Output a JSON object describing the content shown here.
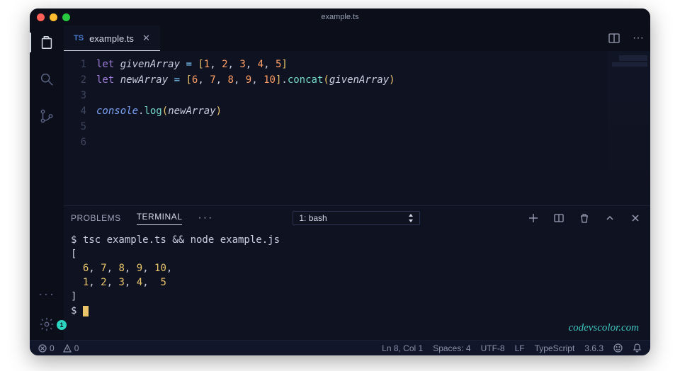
{
  "title": "example.ts",
  "tabs": [
    {
      "badge": "TS",
      "label": "example.ts",
      "close": "✕"
    }
  ],
  "code": {
    "lines": [
      {
        "n": "1",
        "tokens": [
          {
            "t": "let ",
            "c": "kw"
          },
          {
            "t": "givenArray",
            "c": "var"
          },
          {
            "t": " ",
            "c": ""
          },
          {
            "t": "=",
            "c": "op"
          },
          {
            "t": " ",
            "c": ""
          },
          {
            "t": "[",
            "c": "pn"
          },
          {
            "t": "1",
            "c": "num"
          },
          {
            "t": ", ",
            "c": ""
          },
          {
            "t": "2",
            "c": "num"
          },
          {
            "t": ", ",
            "c": ""
          },
          {
            "t": "3",
            "c": "num"
          },
          {
            "t": ", ",
            "c": ""
          },
          {
            "t": "4",
            "c": "num"
          },
          {
            "t": ", ",
            "c": ""
          },
          {
            "t": "5",
            "c": "num"
          },
          {
            "t": "]",
            "c": "pn"
          }
        ]
      },
      {
        "n": "2",
        "tokens": [
          {
            "t": "let ",
            "c": "kw"
          },
          {
            "t": "newArray",
            "c": "var"
          },
          {
            "t": " ",
            "c": ""
          },
          {
            "t": "=",
            "c": "op"
          },
          {
            "t": " ",
            "c": ""
          },
          {
            "t": "[",
            "c": "pn"
          },
          {
            "t": "6",
            "c": "num"
          },
          {
            "t": ", ",
            "c": ""
          },
          {
            "t": "7",
            "c": "num"
          },
          {
            "t": ", ",
            "c": ""
          },
          {
            "t": "8",
            "c": "num"
          },
          {
            "t": ", ",
            "c": ""
          },
          {
            "t": "9",
            "c": "num"
          },
          {
            "t": ", ",
            "c": ""
          },
          {
            "t": "10",
            "c": "num"
          },
          {
            "t": "]",
            "c": "pn"
          },
          {
            "t": ".",
            "c": ""
          },
          {
            "t": "concat",
            "c": "fn"
          },
          {
            "t": "(",
            "c": "pn"
          },
          {
            "t": "givenArray",
            "c": "var"
          },
          {
            "t": ")",
            "c": "pn"
          }
        ]
      },
      {
        "n": "3",
        "tokens": []
      },
      {
        "n": "4",
        "tokens": [
          {
            "t": "console",
            "c": "obj"
          },
          {
            "t": ".",
            "c": ""
          },
          {
            "t": "log",
            "c": "fn"
          },
          {
            "t": "(",
            "c": "pn"
          },
          {
            "t": "newArray",
            "c": "var"
          },
          {
            "t": ")",
            "c": "pn"
          }
        ]
      },
      {
        "n": "5",
        "tokens": []
      },
      {
        "n": "6",
        "tokens": []
      }
    ]
  },
  "panel": {
    "tabs": {
      "problems": "PROBLEMS",
      "terminal": "TERMINAL"
    },
    "more": "···",
    "selector": {
      "label": "1: bash"
    },
    "output": [
      {
        "tokens": [
          {
            "t": "$ tsc example.ts && node example.js",
            "c": ""
          }
        ]
      },
      {
        "tokens": [
          {
            "t": "[",
            "c": ""
          }
        ]
      },
      {
        "tokens": [
          {
            "t": "  ",
            "c": ""
          },
          {
            "t": "6",
            "c": "tnum"
          },
          {
            "t": ", ",
            "c": ""
          },
          {
            "t": "7",
            "c": "tnum"
          },
          {
            "t": ", ",
            "c": ""
          },
          {
            "t": "8",
            "c": "tnum"
          },
          {
            "t": ", ",
            "c": ""
          },
          {
            "t": "9",
            "c": "tnum"
          },
          {
            "t": ", ",
            "c": ""
          },
          {
            "t": "10",
            "c": "tnum"
          },
          {
            "t": ",",
            "c": ""
          }
        ]
      },
      {
        "tokens": [
          {
            "t": "  ",
            "c": ""
          },
          {
            "t": "1",
            "c": "tnum"
          },
          {
            "t": ", ",
            "c": ""
          },
          {
            "t": "2",
            "c": "tnum"
          },
          {
            "t": ", ",
            "c": ""
          },
          {
            "t": "3",
            "c": "tnum"
          },
          {
            "t": ", ",
            "c": ""
          },
          {
            "t": "4",
            "c": "tnum"
          },
          {
            "t": ",  ",
            "c": ""
          },
          {
            "t": "5",
            "c": "tnum"
          }
        ]
      },
      {
        "tokens": [
          {
            "t": "]",
            "c": ""
          }
        ]
      },
      {
        "tokens": [
          {
            "t": "$ ",
            "c": ""
          }
        ],
        "cursor": true
      }
    ]
  },
  "status": {
    "errors": "0",
    "warnings": "0",
    "cursor": "Ln 8, Col 1",
    "spaces": "Spaces: 4",
    "encoding": "UTF-8",
    "eol": "LF",
    "language": "TypeScript",
    "version": "3.6.3"
  },
  "activity": {
    "gear_badge": "1"
  },
  "watermark": "codevscolor.com"
}
